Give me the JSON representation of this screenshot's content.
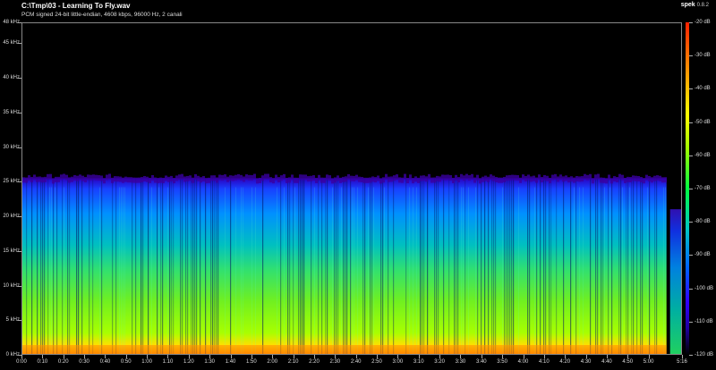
{
  "header": {
    "title": "C:\\Tmp\\03 - Learning To Fly.wav",
    "subtitle": "PCM signed 24-bit little-endian, 4608 kbps, 96000 Hz, 2 canali",
    "app_name": "spek",
    "app_version": "0.8.2"
  },
  "freq_axis": {
    "labels": [
      "48 kHz",
      "45 kHz",
      "40 kHz",
      "35 kHz",
      "30 kHz",
      "25 kHz",
      "20 kHz",
      "15 kHz",
      "10 kHz",
      "5 kHz",
      "0 kHz"
    ],
    "values_khz": [
      48,
      45,
      40,
      35,
      30,
      25,
      20,
      15,
      10,
      5,
      0
    ]
  },
  "time_axis": {
    "labels": [
      "0:00",
      "0:10",
      "0:20",
      "0:30",
      "0:40",
      "0:50",
      "1:00",
      "1:10",
      "1:20",
      "1:30",
      "1:40",
      "1:50",
      "2:00",
      "2:10",
      "2:20",
      "2:30",
      "2:40",
      "2:50",
      "3:00",
      "3:10",
      "3:20",
      "3:30",
      "3:40",
      "3:50",
      "4:00",
      "4:10",
      "4:20",
      "4:30",
      "4:40",
      "4:50",
      "5:00",
      "5:16"
    ],
    "values_s": [
      0,
      10,
      20,
      30,
      40,
      50,
      60,
      70,
      80,
      90,
      100,
      110,
      120,
      130,
      140,
      150,
      160,
      170,
      180,
      190,
      200,
      210,
      220,
      230,
      240,
      250,
      260,
      270,
      280,
      290,
      300,
      316
    ],
    "duration_s": 316
  },
  "colorbar": {
    "labels": [
      "-20 dB",
      "-30 dB",
      "-40 dB",
      "-50 dB",
      "-60 dB",
      "-70 dB",
      "-80 dB",
      "-90 dB",
      "-100 dB",
      "-110 dB",
      "-120 dB"
    ],
    "values_db": [
      -20,
      -30,
      -40,
      -50,
      -60,
      -70,
      -80,
      -90,
      -100,
      -110,
      -120
    ]
  },
  "spectrogram": {
    "max_freq_khz": 48,
    "cutoff_khz": 25.5,
    "tail_start_s": 309,
    "tail_cutoff_khz": 21
  }
}
